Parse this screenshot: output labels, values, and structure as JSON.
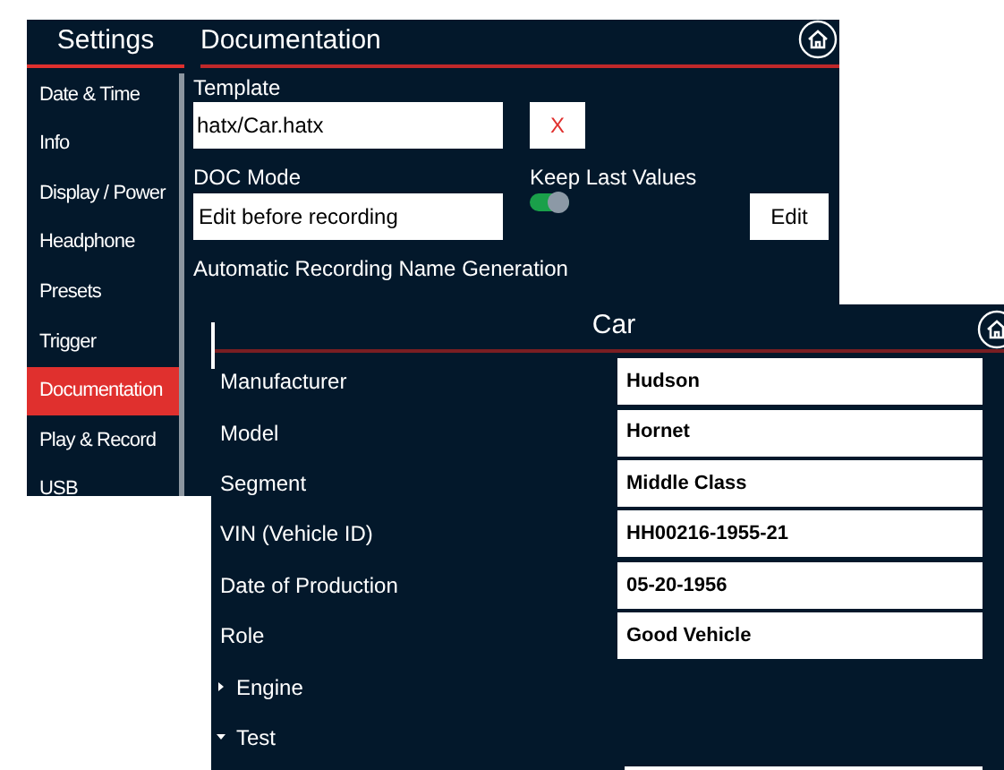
{
  "settings_window": {
    "title": "Settings",
    "page_title": "Documentation",
    "sidebar": {
      "items": [
        {
          "label": "Date & Time",
          "selected": false
        },
        {
          "label": "Info",
          "selected": false
        },
        {
          "label": "Display / Power",
          "selected": false
        },
        {
          "label": "Headphone",
          "selected": false
        },
        {
          "label": "Presets",
          "selected": false
        },
        {
          "label": "Trigger",
          "selected": false
        },
        {
          "label": "Documentation",
          "selected": true
        },
        {
          "label": "Play & Record",
          "selected": false
        },
        {
          "label": "USB",
          "selected": false
        }
      ]
    },
    "template": {
      "label": "Template",
      "value": "hatx/Car.hatx",
      "clear_button": "X"
    },
    "doc_mode": {
      "label": "DOC Mode",
      "value": "Edit before recording"
    },
    "keep_last_values": {
      "label": "Keep Last Values",
      "on": true
    },
    "edit_button": "Edit",
    "section_title": "Automatic Recording Name Generation"
  },
  "car_window": {
    "title": "Car",
    "fields": [
      {
        "kind": "field",
        "label": "Manufacturer",
        "value": "Hudson"
      },
      {
        "kind": "field",
        "label": "Model",
        "value": "Hornet"
      },
      {
        "kind": "field",
        "label": "Segment",
        "value": "Middle Class"
      },
      {
        "kind": "field",
        "label": "VIN (Vehicle ID)",
        "value": "HH00216-1955-21"
      },
      {
        "kind": "field",
        "label": "Date of Production",
        "value": "05-20-1956"
      },
      {
        "kind": "field",
        "label": "Role",
        "value": "Good Vehicle"
      },
      {
        "kind": "group",
        "label": "Engine",
        "expanded": false
      },
      {
        "kind": "group",
        "label": "Test",
        "expanded": true
      }
    ]
  }
}
